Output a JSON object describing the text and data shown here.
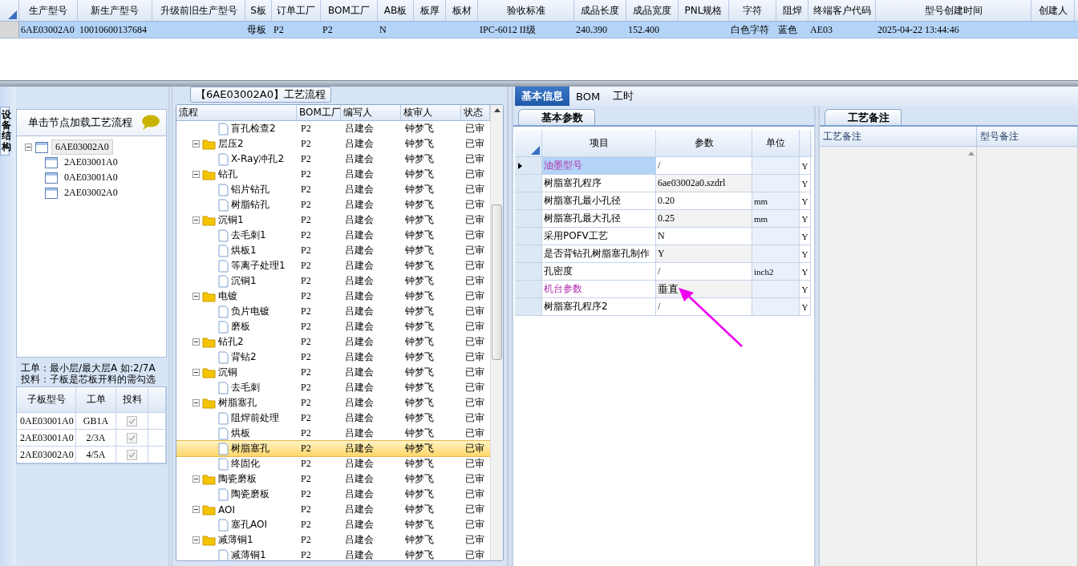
{
  "top_grid": {
    "columns": [
      "生产型号",
      "新生产型号",
      "升级前旧生产型号",
      "S板",
      "订单工厂",
      "BOM工厂",
      "AB板",
      "板厚",
      "板材",
      "验收标准",
      "成品长度",
      "成品宽度",
      "PNL规格",
      "字符",
      "阻焊",
      "终端客户代码",
      "型号创建时间",
      "创建人"
    ],
    "rows": [
      {
        "selected": true,
        "cells": [
          "6AE03002A0",
          "10010600137684",
          null,
          "母板",
          "P2",
          "P2",
          "N",
          null,
          null,
          "IPC-6012 II级",
          "240.390",
          "152.400",
          null,
          "白色字符",
          "蓝色",
          "AE03",
          "2025-04-22 13:44:46",
          null
        ]
      }
    ]
  },
  "left_tab": {
    "label": "设备结构"
  },
  "node_panel": {
    "title": "单击节点加载工艺流程",
    "tree": [
      {
        "label": "6AE03002A0",
        "selected": true,
        "children": [
          {
            "label": "2AE03001A0",
            "selected": false
          },
          {
            "label": "0AE03001A0",
            "selected": false
          },
          {
            "label": "2AE03002A0",
            "selected": false
          }
        ]
      }
    ],
    "note": [
      "工单：最小层/最大层A 如:2/7A",
      "投料：子板是芯板开料的需勾选"
    ],
    "table": {
      "columns": [
        "子板型号",
        "工单",
        "投料"
      ],
      "rows": [
        {
          "board": "0AE03001A0",
          "order": "GB1A",
          "checked": true
        },
        {
          "board": "2AE03001A0",
          "order": "2/3A",
          "checked": true
        },
        {
          "board": "2AE03002A0",
          "order": "4/5A",
          "checked": true
        }
      ]
    }
  },
  "process": {
    "title": "【6AE03002A0】工艺流程",
    "columns": [
      "流程",
      "BOM工厂",
      "编写人",
      "核审人",
      "状态"
    ],
    "rows": [
      {
        "kind": "step",
        "label": "盲孔检查2",
        "bom": "P2",
        "writer": "吕建会",
        "reviewer": "钟梦飞",
        "status": "已审",
        "selected": false
      },
      {
        "kind": "group",
        "label": "层压2",
        "bom": "P2",
        "writer": "吕建会",
        "reviewer": "钟梦飞",
        "status": "已审",
        "selected": false,
        "children": [
          {
            "kind": "step",
            "label": "X-Ray冲孔2",
            "bom": "P2",
            "writer": "吕建会",
            "reviewer": "钟梦飞",
            "status": "已审",
            "selected": false
          }
        ]
      },
      {
        "kind": "group",
        "label": "钻孔",
        "bom": "P2",
        "writer": "吕建会",
        "reviewer": "钟梦飞",
        "status": "已审",
        "selected": false,
        "children": [
          {
            "kind": "step",
            "label": "铝片钻孔",
            "bom": "P2",
            "writer": "吕建会",
            "reviewer": "钟梦飞",
            "status": "已审",
            "selected": false
          },
          {
            "kind": "step",
            "label": "树脂钻孔",
            "bom": "P2",
            "writer": "吕建会",
            "reviewer": "钟梦飞",
            "status": "已审",
            "selected": false
          }
        ]
      },
      {
        "kind": "group",
        "label": "沉铜1",
        "bom": "P2",
        "writer": "吕建会",
        "reviewer": "钟梦飞",
        "status": "已审",
        "selected": false,
        "children": [
          {
            "kind": "step",
            "label": "去毛刺1",
            "bom": "P2",
            "writer": "吕建会",
            "reviewer": "钟梦飞",
            "status": "已审",
            "selected": false
          },
          {
            "kind": "step",
            "label": "烘板1",
            "bom": "P2",
            "writer": "吕建会",
            "reviewer": "钟梦飞",
            "status": "已审",
            "selected": false
          },
          {
            "kind": "step",
            "label": "等离子处理1",
            "bom": "P2",
            "writer": "吕建会",
            "reviewer": "钟梦飞",
            "status": "已审",
            "selected": false
          },
          {
            "kind": "step",
            "label": "沉铜1",
            "bom": "P2",
            "writer": "吕建会",
            "reviewer": "钟梦飞",
            "status": "已审",
            "selected": false
          }
        ]
      },
      {
        "kind": "group",
        "label": "电镀",
        "bom": "P2",
        "writer": "吕建会",
        "reviewer": "钟梦飞",
        "status": "已审",
        "selected": false,
        "children": [
          {
            "kind": "step",
            "label": "负片电镀",
            "bom": "P2",
            "writer": "吕建会",
            "reviewer": "钟梦飞",
            "status": "已审",
            "selected": false
          },
          {
            "kind": "step",
            "label": "磨板",
            "bom": "P2",
            "writer": "吕建会",
            "reviewer": "钟梦飞",
            "status": "已审",
            "selected": false
          }
        ]
      },
      {
        "kind": "group",
        "label": "钻孔2",
        "bom": "P2",
        "writer": "吕建会",
        "reviewer": "钟梦飞",
        "status": "已审",
        "selected": false,
        "children": [
          {
            "kind": "step",
            "label": "背钻2",
            "bom": "P2",
            "writer": "吕建会",
            "reviewer": "钟梦飞",
            "status": "已审",
            "selected": false
          }
        ]
      },
      {
        "kind": "group",
        "label": "沉铜",
        "bom": "P2",
        "writer": "吕建会",
        "reviewer": "钟梦飞",
        "status": "已审",
        "selected": false,
        "children": [
          {
            "kind": "step",
            "label": "去毛刺",
            "bom": "P2",
            "writer": "吕建会",
            "reviewer": "钟梦飞",
            "status": "已审",
            "selected": false
          }
        ]
      },
      {
        "kind": "group",
        "label": "树脂塞孔",
        "bom": "P2",
        "writer": "吕建会",
        "reviewer": "钟梦飞",
        "status": "已审",
        "selected": false,
        "children": [
          {
            "kind": "step",
            "label": "阻焊前处理",
            "bom": "P2",
            "writer": "吕建会",
            "reviewer": "钟梦飞",
            "status": "已审",
            "selected": false
          },
          {
            "kind": "step",
            "label": "烘板",
            "bom": "P2",
            "writer": "吕建会",
            "reviewer": "钟梦飞",
            "status": "已审",
            "selected": false
          },
          {
            "kind": "step",
            "label": "树脂塞孔",
            "bom": "P2",
            "writer": "吕建会",
            "reviewer": "钟梦飞",
            "status": "已审",
            "selected": true
          },
          {
            "kind": "step",
            "label": "终固化",
            "bom": "P2",
            "writer": "吕建会",
            "reviewer": "钟梦飞",
            "status": "已审",
            "selected": false
          }
        ]
      },
      {
        "kind": "group",
        "label": "陶瓷磨板",
        "bom": "P2",
        "writer": "吕建会",
        "reviewer": "钟梦飞",
        "status": "已审",
        "selected": false,
        "children": [
          {
            "kind": "step",
            "label": "陶瓷磨板",
            "bom": "P2",
            "writer": "吕建会",
            "reviewer": "钟梦飞",
            "status": "已审",
            "selected": false
          }
        ]
      },
      {
        "kind": "group",
        "label": "AOI",
        "bom": "P2",
        "writer": "吕建会",
        "reviewer": "钟梦飞",
        "status": "已审",
        "selected": false,
        "children": [
          {
            "kind": "step",
            "label": "塞孔AOI",
            "bom": "P2",
            "writer": "吕建会",
            "reviewer": "钟梦飞",
            "status": "已审",
            "selected": false
          }
        ]
      },
      {
        "kind": "group",
        "label": "减薄铜1",
        "bom": "P2",
        "writer": "吕建会",
        "reviewer": "钟梦飞",
        "status": "已审",
        "selected": false,
        "children": [
          {
            "kind": "step",
            "label": "减薄铜1",
            "bom": "P2",
            "writer": "吕建会",
            "reviewer": "钟梦飞",
            "status": "已审",
            "selected": false
          }
        ]
      }
    ]
  },
  "detail": {
    "tabs": [
      {
        "label": "基本信息",
        "selected": true
      },
      {
        "label": "BOM",
        "selected": false
      },
      {
        "label": "工时",
        "selected": false
      }
    ],
    "params": {
      "tab": "基本参数",
      "columns": [
        "项目",
        "参数",
        "单位"
      ],
      "rows": [
        {
          "item": "油墨型号",
          "value": "/",
          "unit": null,
          "flag": "Y",
          "highlighted": true,
          "selected": true
        },
        {
          "item": "树脂塞孔程序",
          "value": "6ae03002a0.szdrl",
          "unit": null,
          "flag": "Y",
          "highlighted": false,
          "selected": false
        },
        {
          "item": "树脂塞孔最小孔径",
          "value": "0.20",
          "unit": "mm",
          "flag": "Y",
          "highlighted": false,
          "selected": false
        },
        {
          "item": "树脂塞孔最大孔径",
          "value": "0.25",
          "unit": "mm",
          "flag": "Y",
          "highlighted": false,
          "selected": false
        },
        {
          "item": "采用POFV工艺",
          "value": "N",
          "unit": null,
          "flag": "Y",
          "highlighted": false,
          "selected": false
        },
        {
          "item": "是否背钻孔树脂塞孔制作",
          "value": "Y",
          "unit": null,
          "flag": "Y",
          "highlighted": false,
          "selected": false
        },
        {
          "item": "孔密度",
          "value": "/",
          "unit": "inch2",
          "flag": "Y",
          "highlighted": false,
          "selected": false
        },
        {
          "item": "机台参数",
          "value": "垂直",
          "unit": null,
          "flag": "Y",
          "highlighted": true,
          "selected": false
        },
        {
          "item": "树脂塞孔程序2",
          "value": "/",
          "unit": null,
          "flag": "Y",
          "highlighted": false,
          "selected": false
        }
      ]
    },
    "remarks": {
      "tab": "工艺备注",
      "columns": [
        "工艺备注",
        "型号备注"
      ]
    }
  }
}
